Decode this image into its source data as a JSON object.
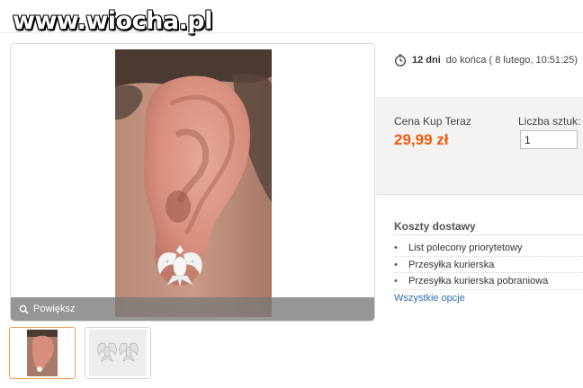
{
  "watermark": {
    "text": "www.wiocha.pl"
  },
  "gallery": {
    "zoom_label": "Powiększ",
    "thumbnails": [
      {
        "alt": "ear-with-eagle-earring",
        "active": true
      },
      {
        "alt": "pair-of-eagle-earrings",
        "active": false
      }
    ]
  },
  "timer": {
    "days_bold": "12 dni",
    "rest": "do końca ( 8 lutego, 10:51:25)"
  },
  "price": {
    "label": "Cena Kup Teraz",
    "value": "29,99 zł",
    "color": "#f15a0c"
  },
  "quantity": {
    "label": "Liczba sztuk:",
    "value": "1"
  },
  "shipping": {
    "title": "Koszty dostawy",
    "items": [
      "List polecony priorytetowy",
      "Przesyłka kurierska",
      "Przesyłka kurierska pobraniowa"
    ],
    "all_options": "Wszystkie opcje",
    "link_color": "#2f6db3"
  }
}
